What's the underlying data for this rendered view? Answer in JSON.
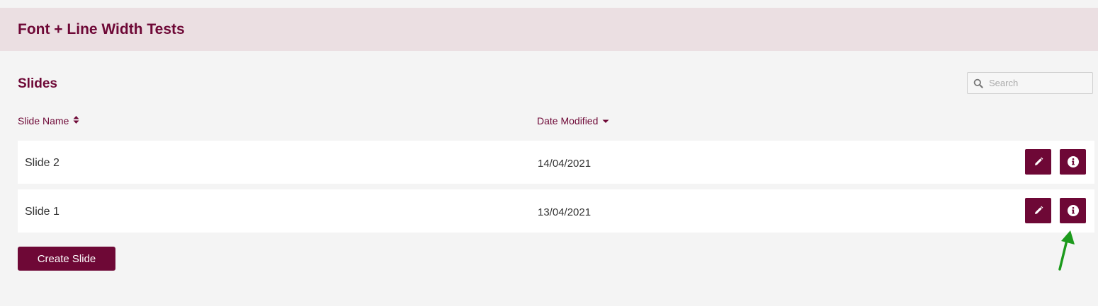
{
  "header": {
    "title": "Font + Line Width Tests"
  },
  "section": {
    "title": "Slides"
  },
  "search": {
    "placeholder": "Search",
    "value": "",
    "icon": "search-icon"
  },
  "table": {
    "columns": [
      {
        "label": "Slide Name",
        "sort": "both",
        "icon": "sort-both-icon"
      },
      {
        "label": "Date Modified",
        "sort": "descending",
        "icon": "sort-down-icon"
      }
    ],
    "rows": [
      {
        "name": "Slide 2",
        "date": "14/04/2021"
      },
      {
        "name": "Slide 1",
        "date": "13/04/2021"
      }
    ],
    "row_actions": [
      {
        "icon": "pencil-icon",
        "action": "edit"
      },
      {
        "icon": "info-icon",
        "action": "info"
      }
    ]
  },
  "actions": {
    "create_label": "Create Slide"
  },
  "annotation": {
    "icon": "green-arrow-icon",
    "color": "#1c9a1c"
  },
  "colors": {
    "brand": "#6e0836",
    "header_bg": "#ebdfe2",
    "page_bg": "#f4f4f4",
    "row_bg": "#ffffff"
  }
}
